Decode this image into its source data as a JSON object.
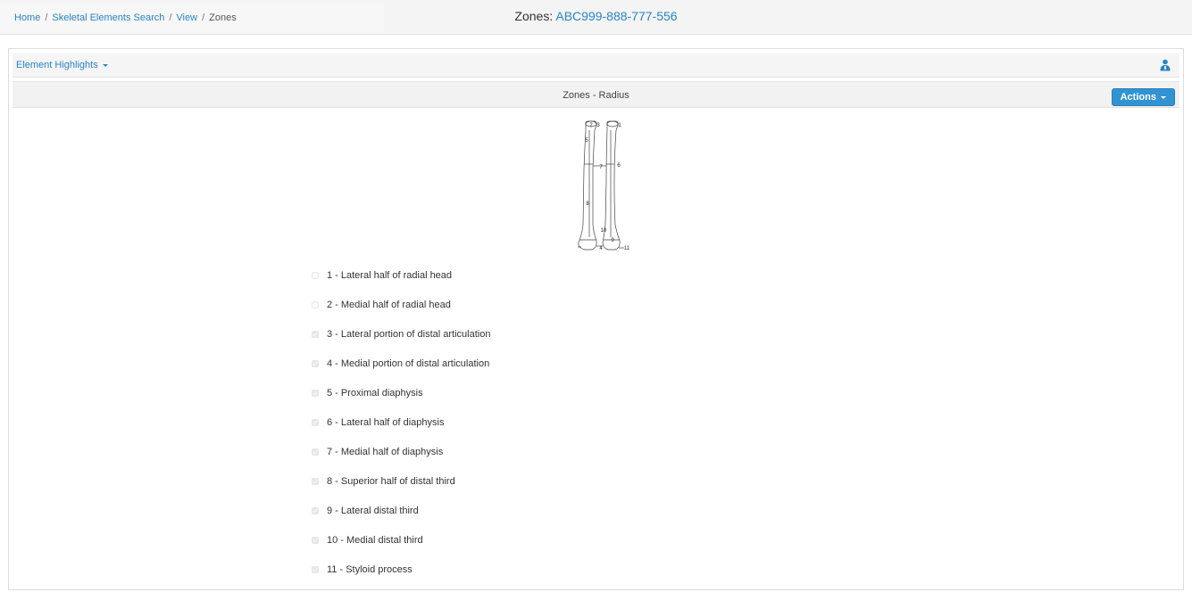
{
  "breadcrumb": {
    "items": [
      "Home",
      "Skeletal Elements Search",
      "View"
    ],
    "current": "Zones"
  },
  "page": {
    "title_prefix": "Zones:",
    "record_id": "ABC999-888-777-556"
  },
  "panel": {
    "highlights_label": "Element Highlights",
    "subtitle": "Zones - Radius",
    "actions_label": "Actions"
  },
  "diagram": {
    "labels": [
      "1",
      "2",
      "3",
      "4",
      "5",
      "6",
      "7",
      "8",
      "9",
      "10",
      "11"
    ]
  },
  "zones": [
    {
      "label": "1 - Lateral half of radial head",
      "checked": false
    },
    {
      "label": "2 - Medial half of radial head",
      "checked": false
    },
    {
      "label": "3 - Lateral portion of distal articulation",
      "checked": true
    },
    {
      "label": "4 - Medial portion of distal articulation",
      "checked": true
    },
    {
      "label": "5 - Proximal diaphysis",
      "checked": true
    },
    {
      "label": "6 - Lateral half of diaphysis",
      "checked": true
    },
    {
      "label": "7 - Medial half of diaphysis",
      "checked": true
    },
    {
      "label": "8 - Superior half of distal third",
      "checked": true
    },
    {
      "label": "9 - Lateral distal third",
      "checked": true
    },
    {
      "label": "10 - Medial distal third",
      "checked": true
    },
    {
      "label": "11 - Styloid process",
      "checked": true
    }
  ],
  "colors": {
    "link": "#2a83c2",
    "button": "#3293d2",
    "header_bg": "#f4f4f4"
  },
  "icons": {
    "user": "user-icon",
    "caret": "caret-down-icon"
  }
}
